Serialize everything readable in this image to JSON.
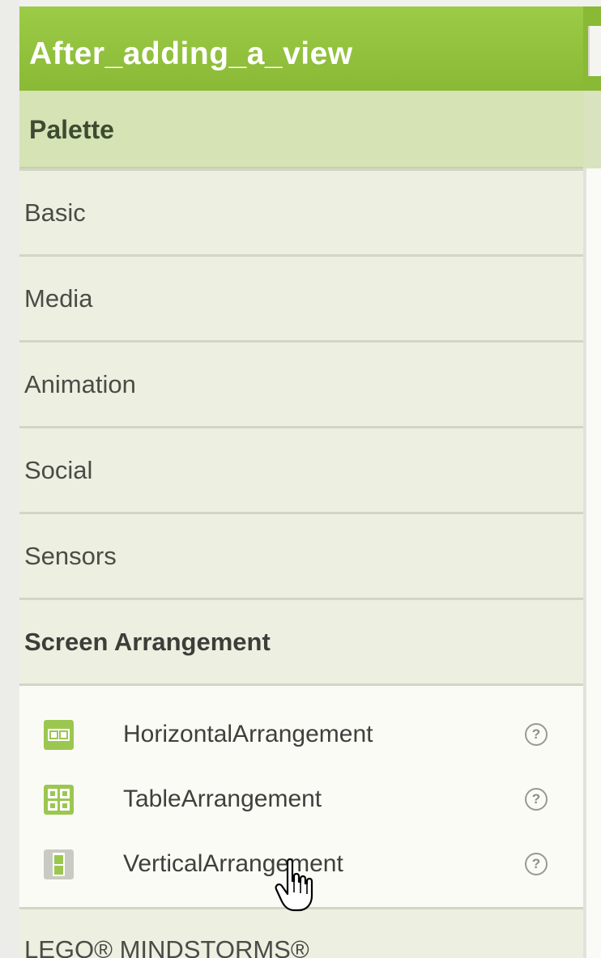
{
  "project": {
    "title": "After_adding_a_view"
  },
  "palette": {
    "header": "Palette",
    "categories": [
      {
        "label": "Basic"
      },
      {
        "label": "Media"
      },
      {
        "label": "Animation"
      },
      {
        "label": "Social"
      },
      {
        "label": "Sensors"
      },
      {
        "label": "Screen Arrangement"
      }
    ],
    "items": [
      {
        "label": "HorizontalArrangement",
        "icon": "horizontal-arrangement-icon",
        "help": "?"
      },
      {
        "label": "TableArrangement",
        "icon": "table-arrangement-icon",
        "help": "?"
      },
      {
        "label": "VerticalArrangement",
        "icon": "vertical-arrangement-icon",
        "help": "?"
      }
    ],
    "next_category": "LEGO® MINDSTORMS®"
  },
  "colors": {
    "title_bar": "#8ab935",
    "palette_header": "#d5e3b5",
    "category_bg": "#edf0e1",
    "icon_green": "#9bc750"
  }
}
